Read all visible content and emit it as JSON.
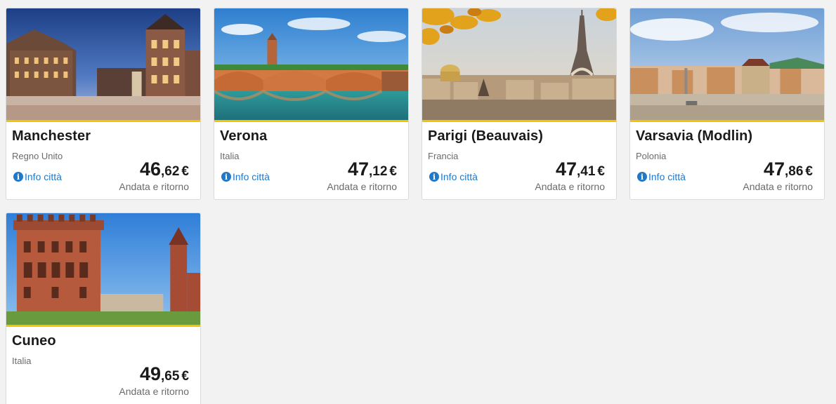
{
  "destinations": [
    {
      "city": "Manchester",
      "country": "Regno Unito",
      "info_label": "Info città",
      "price_int": "46",
      "price_dec": ",62",
      "currency": "€",
      "fare_type": "Andata e ritorno",
      "image": "manchester-town-hall-photo"
    },
    {
      "city": "Verona",
      "country": "Italia",
      "info_label": "Info città",
      "price_int": "47",
      "price_dec": ",12",
      "currency": "€",
      "fare_type": "Andata e ritorno",
      "image": "verona-bridge-photo"
    },
    {
      "city": "Parigi (Beauvais)",
      "country": "Francia",
      "info_label": "Info città",
      "price_int": "47",
      "price_dec": ",41",
      "currency": "€",
      "fare_type": "Andata e ritorno",
      "image": "paris-eiffel-tower-photo"
    },
    {
      "city": "Varsavia (Modlin)",
      "country": "Polonia",
      "info_label": "Info città",
      "price_int": "47",
      "price_dec": ",86",
      "currency": "€",
      "fare_type": "Andata e ritorno",
      "image": "warsaw-castle-square-photo"
    },
    {
      "city": "Cuneo",
      "country": "Italia",
      "info_label": "",
      "price_int": "49",
      "price_dec": ",65",
      "currency": "€",
      "fare_type": "Andata e ritorno",
      "image": "cuneo-tower-photo"
    }
  ],
  "colors": {
    "accent_yellow": "#f4c400",
    "link_blue": "#1f78c8",
    "background": "#f2f2f2"
  }
}
